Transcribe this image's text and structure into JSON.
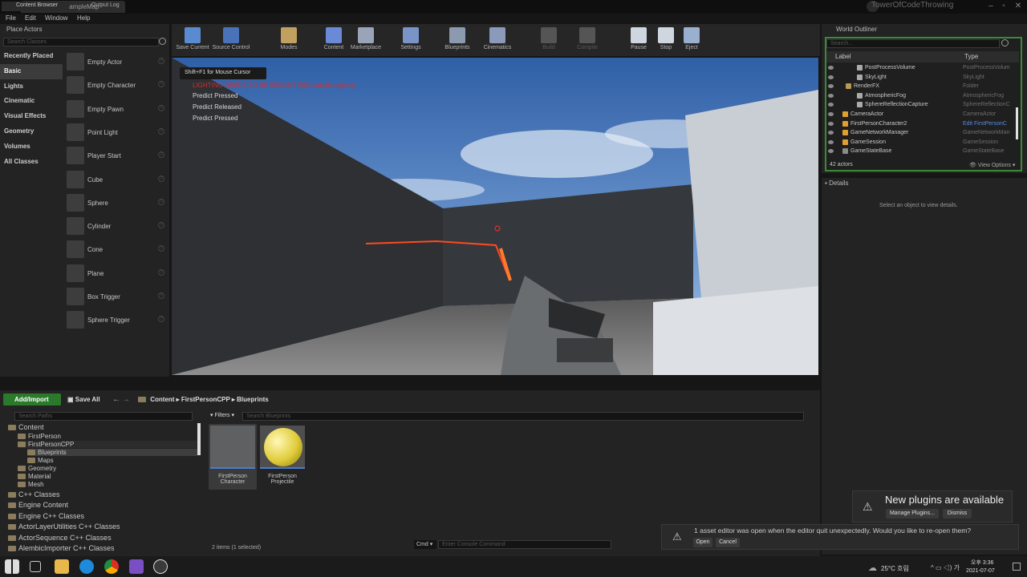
{
  "window": {
    "map_tab": "FirstPersonExampleMap",
    "project": "TowerOfCodeThrowing"
  },
  "menu": [
    "File",
    "Edit",
    "Window",
    "Help"
  ],
  "toolbar": [
    {
      "label": "Save Current",
      "icon": "save-icon",
      "dim": false
    },
    {
      "label": "Source Control",
      "icon": "source-control-icon",
      "dim": false
    },
    {
      "label": "Modes",
      "icon": "modes-icon",
      "dim": false
    },
    {
      "label": "Content",
      "icon": "content-icon",
      "dim": false
    },
    {
      "label": "Marketplace",
      "icon": "marketplace-icon",
      "dim": false
    },
    {
      "label": "Settings",
      "icon": "settings-icon",
      "dim": false
    },
    {
      "label": "Blueprints",
      "icon": "blueprints-icon",
      "dim": false
    },
    {
      "label": "Cinematics",
      "icon": "cinematics-icon",
      "dim": false
    },
    {
      "label": "Build",
      "icon": "build-icon",
      "dim": true
    },
    {
      "label": "Compile",
      "icon": "compile-icon",
      "dim": true
    },
    {
      "label": "Pause",
      "icon": "pause-icon",
      "dim": false
    },
    {
      "label": "Stop",
      "icon": "stop-icon",
      "dim": false
    },
    {
      "label": "Eject",
      "icon": "eject-icon",
      "dim": false
    }
  ],
  "place_actors": {
    "tab": "Place Actors",
    "search_placeholder": "Search Classes",
    "categories": [
      "Recently Placed",
      "Basic",
      "Lights",
      "Cinematic",
      "Visual Effects",
      "Geometry",
      "Volumes",
      "All Classes"
    ],
    "selected_category": "Basic",
    "actors": [
      "Empty Actor",
      "Empty Character",
      "Empty Pawn",
      "Point Light",
      "Player Start",
      "Cube",
      "Sphere",
      "Cylinder",
      "Cone",
      "Plane",
      "Box Trigger",
      "Sphere Trigger"
    ]
  },
  "viewport": {
    "mouse_hint": "Shift+F1 for Mouse Cursor",
    "warning": "LIGHTING NEEDS TO BE REBUILT (982 unbuilt objects)",
    "log": [
      "Predict Pressed",
      "Predict Released",
      "Predict Pressed"
    ]
  },
  "outliner": {
    "tab": "World Outliner",
    "search_placeholder": "Search...",
    "col_label": "Label",
    "col_type": "Type",
    "rows": [
      {
        "label": "PostProcessVolume",
        "type": "PostProcessVolum"
      },
      {
        "label": "SkyLight",
        "type": "SkyLight"
      },
      {
        "label": "RenderFX",
        "type": "Folder"
      },
      {
        "label": "AtmosphericFog",
        "type": "AtmosphericFog"
      },
      {
        "label": "SphereReflectionCapture",
        "type": "SphereReflectionC"
      },
      {
        "label": "CameraActor",
        "type": "CameraActor"
      },
      {
        "label": "FirstPersonCharacter2",
        "type": "Edit FirstPersonC"
      },
      {
        "label": "GameNetworkManager",
        "type": "GameNetworkMan"
      },
      {
        "label": "GameSession",
        "type": "GameSession"
      },
      {
        "label": "GameStateBase",
        "type": "GameStateBase"
      }
    ],
    "count": "42 actors",
    "view_options": "View Options"
  },
  "details": {
    "tab": "Details",
    "empty": "Select an object to view details."
  },
  "content_browser": {
    "tabs": [
      "Content Browser",
      "Output Log"
    ],
    "add_import": "Add/Import",
    "save_all": "Save All",
    "breadcrumb": [
      "Content",
      "FirstPersonCPP",
      "Blueprints"
    ],
    "path_placeholder": "Search Paths",
    "filters": "Filters",
    "asset_placeholder": "Search Blueprints",
    "tree": [
      "Content",
      "FirstPerson",
      "FirstPersonCPP",
      "Blueprints",
      "Maps",
      "Geometry",
      "Material",
      "Mesh"
    ],
    "classes": [
      "C++ Classes",
      "Engine Content",
      "Engine C++ Classes",
      "ActorLayerUtilities C++ Classes",
      "ActorSequence C++ Classes",
      "AlembicImporter C++ Classes"
    ],
    "assets": [
      {
        "line1": "FirstPerson",
        "line2": "Character"
      },
      {
        "line1": "FirstPerson",
        "line2": "Projectile"
      }
    ],
    "status": "2 items (1 selected)",
    "cmd": "Cmd",
    "console_placeholder": "Enter Console Command"
  },
  "notifications": {
    "plugins_title": "New plugins are available",
    "manage": "Manage Plugins...",
    "dismiss": "Dismiss",
    "reopen": "1 asset editor was open when the editor quit unexpectedly. Would you like to re-open them?",
    "open": "Open",
    "cancel": "Cancel"
  },
  "taskbar": {
    "weather": "25°C 흐림",
    "time": "오후 3:36",
    "date": "2021-07-07"
  }
}
